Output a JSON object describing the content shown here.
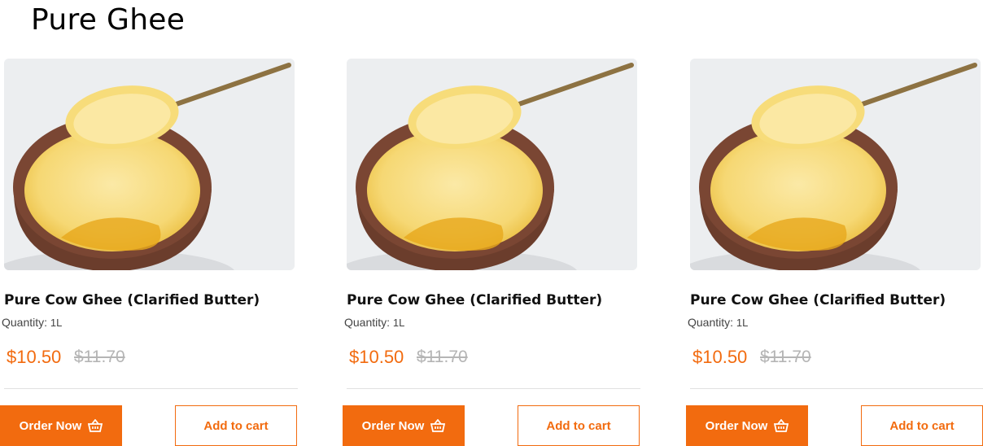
{
  "page": {
    "title": "Pure Ghee"
  },
  "products": [
    {
      "name": "Pure Cow Ghee (Clarified Butter)",
      "quantity_label": "Quantity:",
      "quantity_value": "1L",
      "price": "$10.50",
      "old_price": "$11.70",
      "order_label": "Order Now",
      "cart_label": "Add to cart",
      "image_icon": "ghee-bowl-image"
    },
    {
      "name": "Pure Cow Ghee (Clarified Butter)",
      "quantity_label": "Quantity:",
      "quantity_value": "1L",
      "price": "$10.50",
      "old_price": "$11.70",
      "order_label": "Order Now",
      "cart_label": "Add to cart",
      "image_icon": "ghee-bowl-image"
    },
    {
      "name": "Pure Cow Ghee (Clarified Butter)",
      "quantity_label": "Quantity:",
      "quantity_value": "1L",
      "price": "$10.50",
      "old_price": "$11.70",
      "order_label": "Order Now",
      "cart_label": "Add to cart",
      "image_icon": "ghee-bowl-image"
    }
  ],
  "colors": {
    "accent": "#f26b0f",
    "old_price": "#b5b5b5",
    "divider": "#e1e1e1"
  },
  "icons": {
    "order": "basket-icon"
  }
}
